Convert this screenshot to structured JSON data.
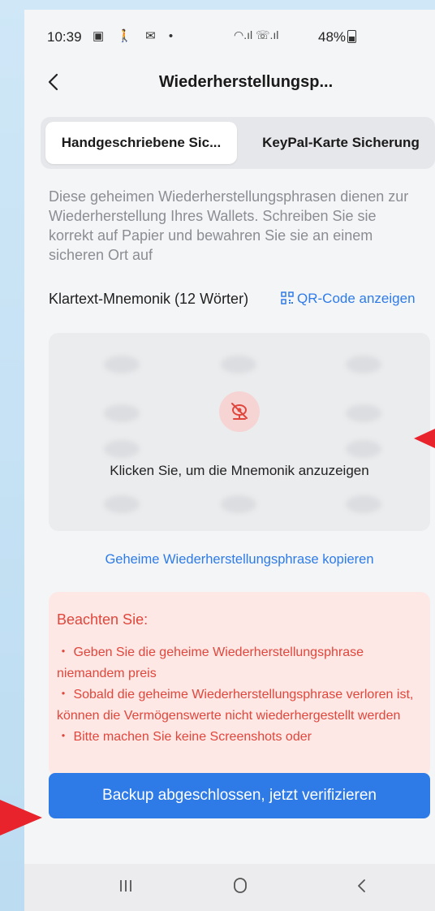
{
  "status_bar": {
    "time": "10:39",
    "left_icons": "▣ 🚶 ✉ •",
    "right_icons": "◠.ıl ☏.ıl",
    "battery": "48%"
  },
  "header": {
    "title": "Wiederherstellungsp..."
  },
  "tabs": [
    {
      "label": "Handgeschriebene Sic...",
      "active": true
    },
    {
      "label": "KeyPal-Karte Sicherung",
      "active": false
    }
  ],
  "description": "Diese geheimen Wiederherstellungsphrasen dienen zur Wiederherstellung Ihres Wallets. Schreiben Sie sie korrekt auf Papier und bewahren Sie sie an einem sicheren Ort auf",
  "mnemonic": {
    "label": "Klartext-Mnemonik (12 Wörter)",
    "qr_link": "QR-Code anzeigen",
    "reveal_text": "Klicken Sie, um die Mnemonik anzuzeigen"
  },
  "copy_link": "Geheime Wiederherstellungsphrase kopieren",
  "warning": {
    "title": "Beachten Sie:",
    "items": [
      "・ Geben Sie die geheime Wiederherstellungsphrase niemandem preis",
      "・ Sobald die geheime Wiederherstellungsphrase verloren ist, können die Vermögenswerte nicht wiederhergestellt werden",
      "・ Bitte machen Sie keine Screenshots oder"
    ]
  },
  "cta_button": "Backup abgeschlossen, jetzt verifizieren",
  "colors": {
    "accent": "#2e7be8",
    "warning_text": "#e0463b",
    "warning_bg": "#fde8e6",
    "annotation_arrow": "#e8232b"
  },
  "icons": {
    "back": "chevron-left-icon",
    "qr": "qr-code-icon",
    "hidden": "eye-off-icon",
    "nav_recents": "recents-icon",
    "nav_home": "home-icon",
    "nav_back": "nav-back-icon"
  }
}
